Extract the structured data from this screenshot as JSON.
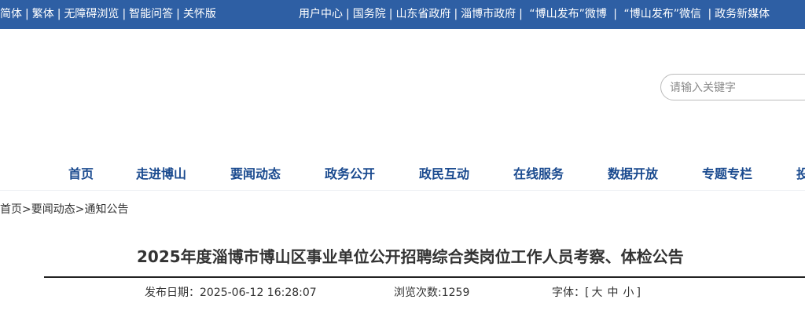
{
  "topbar": {
    "left_links": [
      "简体",
      "繁体",
      "无障碍浏览",
      "智能问答",
      "关怀版"
    ],
    "right_links": [
      "用户中心",
      "国务院",
      "山东省政府",
      "淄博市政府",
      "“博山发布”微博",
      "“博山发布”微信",
      "政务新媒体"
    ],
    "separator": "|"
  },
  "search": {
    "placeholder": "请输入关键字"
  },
  "nav": {
    "items": [
      "首页",
      "走进博山",
      "要闻动态",
      "政务公开",
      "政民互动",
      "在线服务",
      "数据开放",
      "专题专栏",
      "投"
    ]
  },
  "breadcrumb": {
    "items": [
      "首页",
      "要闻动态",
      "通知公告"
    ],
    "separator": ">"
  },
  "article": {
    "title": "2025年度淄博市博山区事业单位公开招聘综合类岗位工作人员考察、体检公告",
    "publish_label": "发布日期：",
    "publish_date": "2025-06-12 16:28:07",
    "views_label": "浏览次数:",
    "views": "1259",
    "font_label": "字体：",
    "font_open": "[",
    "font_sizes": [
      "大",
      "中",
      "小"
    ],
    "font_close": "]"
  },
  "colors": {
    "topbar_bg": "#2e5fa4",
    "nav_text": "#1a4a8f"
  }
}
